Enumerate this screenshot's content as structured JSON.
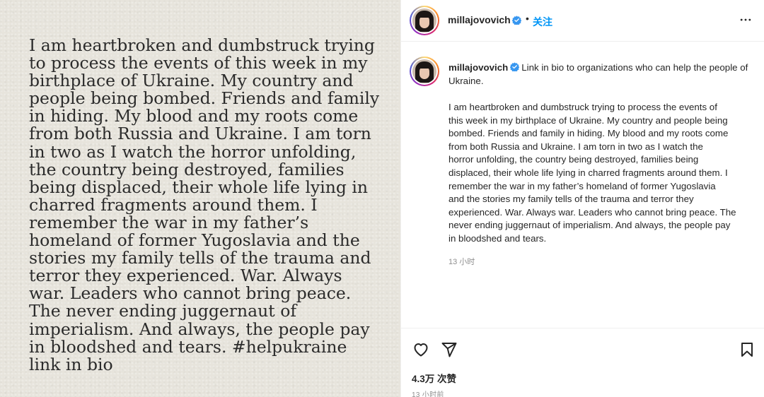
{
  "image": {
    "text": "I am heartbroken and dumbstruck trying\nto process the events of this week in my\nbirthplace of Ukraine. My country and\npeople being bombed. Friends and family\nin hiding. My blood and my roots come\nfrom both Russia and Ukraine. I am torn\nin two as I watch the horror unfolding,\nthe country being destroyed, families\nbeing displaced, their whole life lying in\ncharred fragments around them. I\nremember the war in my father’s\nhomeland of former Yugoslavia and the\nstories my family tells of the trauma and\nterror they experienced. War. Always\nwar. Leaders who cannot bring peace.\nThe never ending juggernaut of\nimperialism. And always, the people pay\nin bloodshed and tears. #helpukraine\nlink in bio"
  },
  "header": {
    "username": "millajovovich",
    "dot": "•",
    "follow_label": "关注"
  },
  "caption": {
    "username": "millajovovich",
    "intro": "Link in bio to organizations who can help the people of Ukraine.",
    "body": "I am heartbroken and dumbstruck trying to process the events of\nthis week in my birthplace of Ukraine. My country and people being\nbombed. Friends and family in hiding. My blood and my roots come\nfrom both Russia and Ukraine. I am torn in two as I watch the\nhorror unfolding, the country being destroyed, families being\ndisplaced, their whole life lying in charred fragments around them. I\nremember the war in my father’s homeland of former Yugoslavia\nand the stories my family tells of the trauma and terror they\nexperienced. War. Always war. Leaders who cannot bring peace. The\nnever ending juggernaut of imperialism. And always, the people pay\nin bloodshed and tears.",
    "time": "13 小时"
  },
  "actions": {
    "likes": "4.3万 次赞",
    "time": "13 小时前"
  },
  "colors": {
    "accent": "#0095f6",
    "text": "#262626",
    "muted": "#8e8e8e",
    "paper": "#e7e4dc"
  },
  "icons": [
    "verified-badge-icon",
    "more-options-icon",
    "heart-icon",
    "share-icon",
    "bookmark-icon"
  ]
}
